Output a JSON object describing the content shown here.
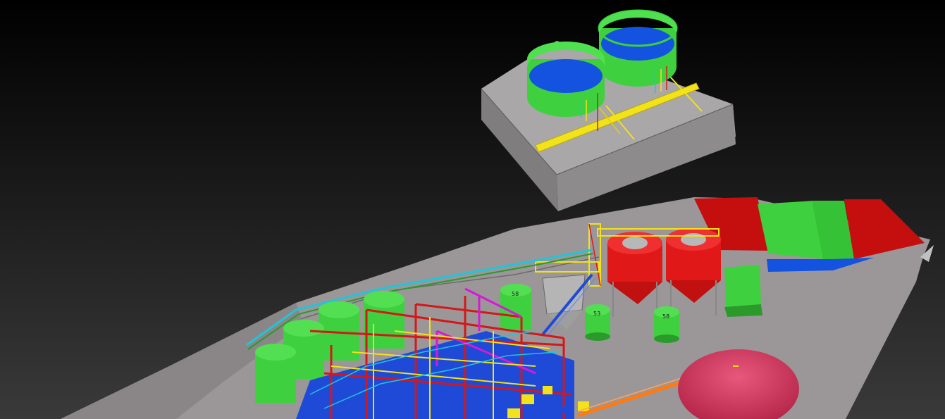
{
  "viewport": {
    "background_top": "#000000",
    "background_bottom": "#3a3a3a"
  },
  "colors": {
    "terrain": "#9a9698",
    "terrain_edge": "#5e5a5c",
    "slab_top": "#a7a5a6",
    "slab_left": "#7f7d7e",
    "slab_right": "#8f8d8e",
    "tank_green": "#3ed03e",
    "tank_green_dark": "#2a9a2a",
    "water_blue": "#1452e0",
    "silo_red": "#e01818",
    "silo_red_dark": "#a00e0e",
    "stockpile_pink": "#d83560",
    "structure_red": "#d41818",
    "structure_blue": "#1f4ad8",
    "structure_yellow": "#f2e21a",
    "structure_magenta": "#d818d8",
    "conveyor_orange": "#ff7a10",
    "pipe_cyan": "#22c4d8"
  },
  "equipment_tags": {
    "tank_left": "58",
    "tank_mid": "53",
    "tank_right": "58",
    "tank_back": "58"
  }
}
